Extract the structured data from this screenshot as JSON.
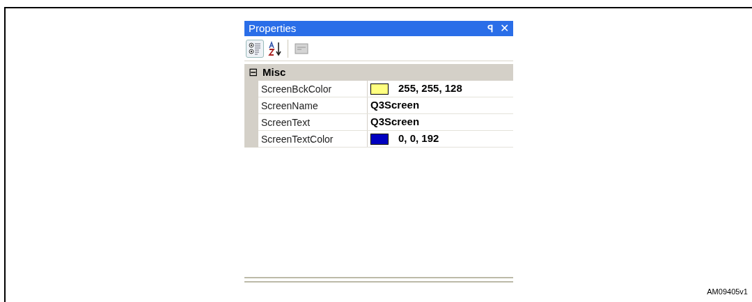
{
  "panel": {
    "title": "Properties",
    "pin_glyph": "ꟼ",
    "close_glyph": "✕"
  },
  "toolbar": [
    {
      "kind": "categorized",
      "selected": true
    },
    {
      "kind": "alphabetical",
      "selected": false
    },
    {
      "kind": "pages",
      "selected": false
    }
  ],
  "category": {
    "name": "Misc",
    "expanded": true,
    "toggle": "⊟"
  },
  "properties": [
    {
      "name": "ScreenBckColor",
      "kind": "color",
      "color": "#ffff80",
      "value": "255, 255, 128"
    },
    {
      "name": "ScreenName",
      "kind": "text",
      "value": "Q3Screen"
    },
    {
      "name": "ScreenText",
      "kind": "text",
      "value": "Q3Screen"
    },
    {
      "name": "ScreenTextColor",
      "kind": "color",
      "color": "#0000c0",
      "value": "0, 0, 192"
    }
  ],
  "figure_id": "AM09405v1"
}
